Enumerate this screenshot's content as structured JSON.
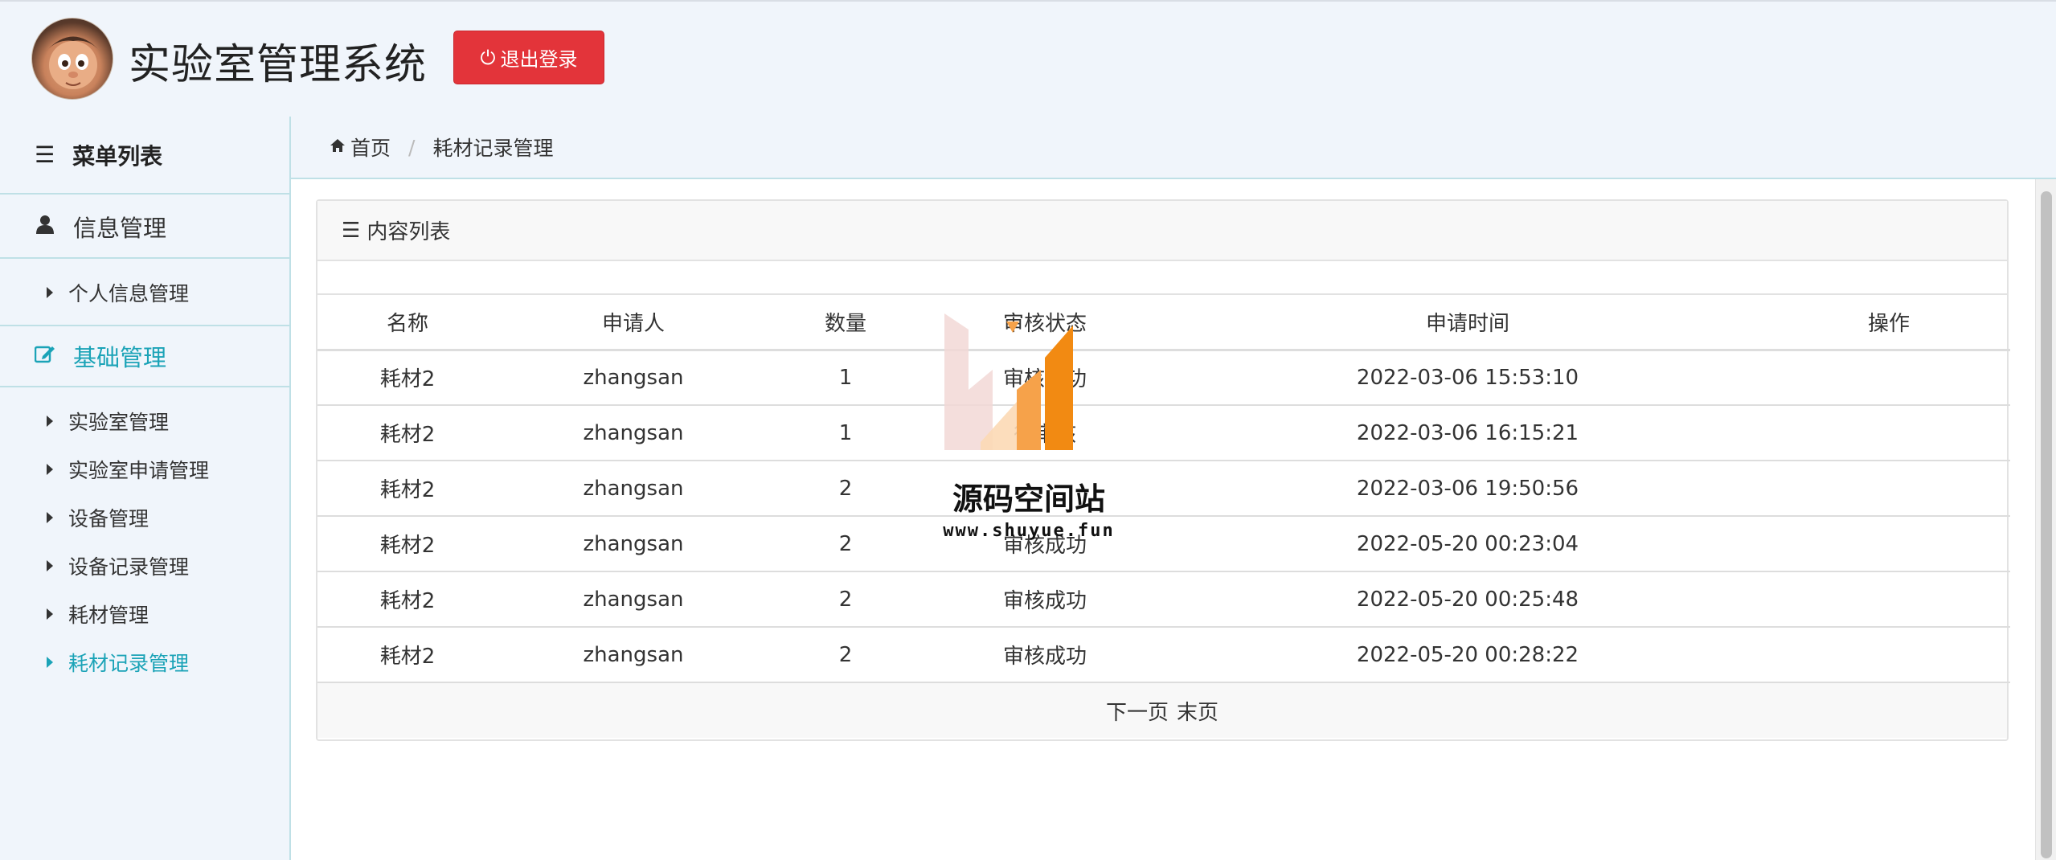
{
  "header": {
    "title": "实验室管理系统",
    "logout_label": "退出登录"
  },
  "sidebar": {
    "menu_title": "菜单列表",
    "groups": [
      {
        "label": "信息管理",
        "items": [
          "个人信息管理"
        ]
      },
      {
        "label": "基础管理",
        "items": [
          "实验室管理",
          "实验室申请管理",
          "设备管理",
          "设备记录管理",
          "耗材管理",
          "耗材记录管理"
        ]
      }
    ],
    "active_item": "耗材记录管理"
  },
  "breadcrumb": {
    "home": "首页",
    "current": "耗材记录管理"
  },
  "panel": {
    "title": "内容列表",
    "columns": [
      "名称",
      "申请人",
      "数量",
      "审核状态",
      "申请时间",
      "操作"
    ],
    "rows": [
      {
        "name": "耗材2",
        "applicant": "zhangsan",
        "qty": "1",
        "status": "审核成功",
        "time": "2022-03-06 15:53:10",
        "action": ""
      },
      {
        "name": "耗材2",
        "applicant": "zhangsan",
        "qty": "1",
        "status": "待审核",
        "time": "2022-03-06 16:15:21",
        "action": ""
      },
      {
        "name": "耗材2",
        "applicant": "zhangsan",
        "qty": "2",
        "status": "",
        "time": "2022-03-06 19:50:56",
        "action": ""
      },
      {
        "name": "耗材2",
        "applicant": "zhangsan",
        "qty": "2",
        "status": "审核成功",
        "time": "2022-05-20 00:23:04",
        "action": ""
      },
      {
        "name": "耗材2",
        "applicant": "zhangsan",
        "qty": "2",
        "status": "审核成功",
        "time": "2022-05-20 00:25:48",
        "action": ""
      },
      {
        "name": "耗材2",
        "applicant": "zhangsan",
        "qty": "2",
        "status": "审核成功",
        "time": "2022-05-20 00:28:22",
        "action": ""
      }
    ],
    "pager": {
      "next": "下一页",
      "last": "末页"
    }
  },
  "watermark": {
    "text": "源码空间站",
    "url": "www.shuyue.fun"
  },
  "colors": {
    "logout_bg": "#e3343a",
    "active_accent": "#1ba3b7"
  }
}
